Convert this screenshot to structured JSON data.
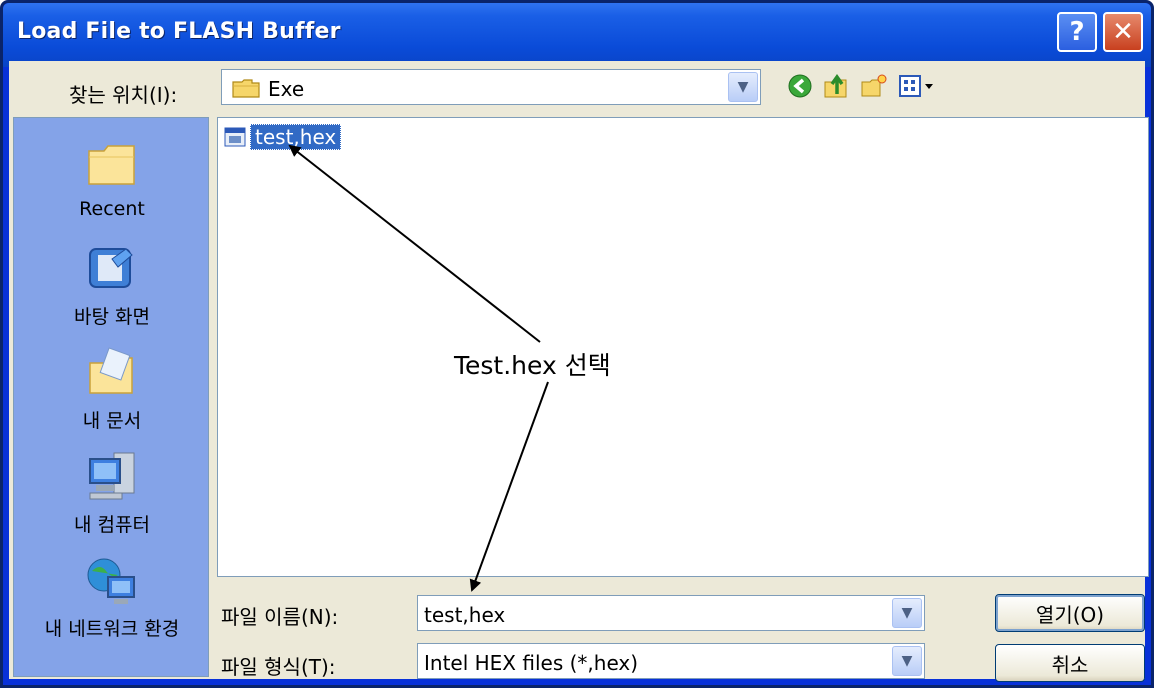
{
  "window": {
    "title": "Load File to FLASH Buffer"
  },
  "titlebar": {
    "help_glyph": "?",
    "close_glyph": "✕"
  },
  "lookin": {
    "label": "찾는 위치(I):",
    "value": "Exe"
  },
  "toolbar": {
    "icons": [
      "back-icon",
      "up-folder-icon",
      "new-folder-icon",
      "view-menu-icon"
    ]
  },
  "places": [
    {
      "label": "Recent",
      "icon": "recent-folder-icon"
    },
    {
      "label": "바탕 화면",
      "icon": "desktop-icon"
    },
    {
      "label": "내 문서",
      "icon": "my-documents-icon"
    },
    {
      "label": "내 컴퓨터",
      "icon": "my-computer-icon"
    },
    {
      "label": "내 네트워크 환경",
      "icon": "network-icon"
    }
  ],
  "files": [
    {
      "name": "test,hex",
      "selected": true,
      "icon": "hex-file-icon"
    }
  ],
  "filename": {
    "label": "파일 이름(N):",
    "value": "test,hex"
  },
  "filetype": {
    "label": "파일 형식(T):",
    "value": "Intel HEX files (*,hex)"
  },
  "buttons": {
    "open": "열기(O)",
    "cancel": "취소"
  },
  "annotation": {
    "text": "Test.hex 선택"
  },
  "colors": {
    "titlebar": "#0a4bd8",
    "selection": "#316ac5",
    "places_bg": "#84a3e8",
    "face": "#ece9d8"
  }
}
